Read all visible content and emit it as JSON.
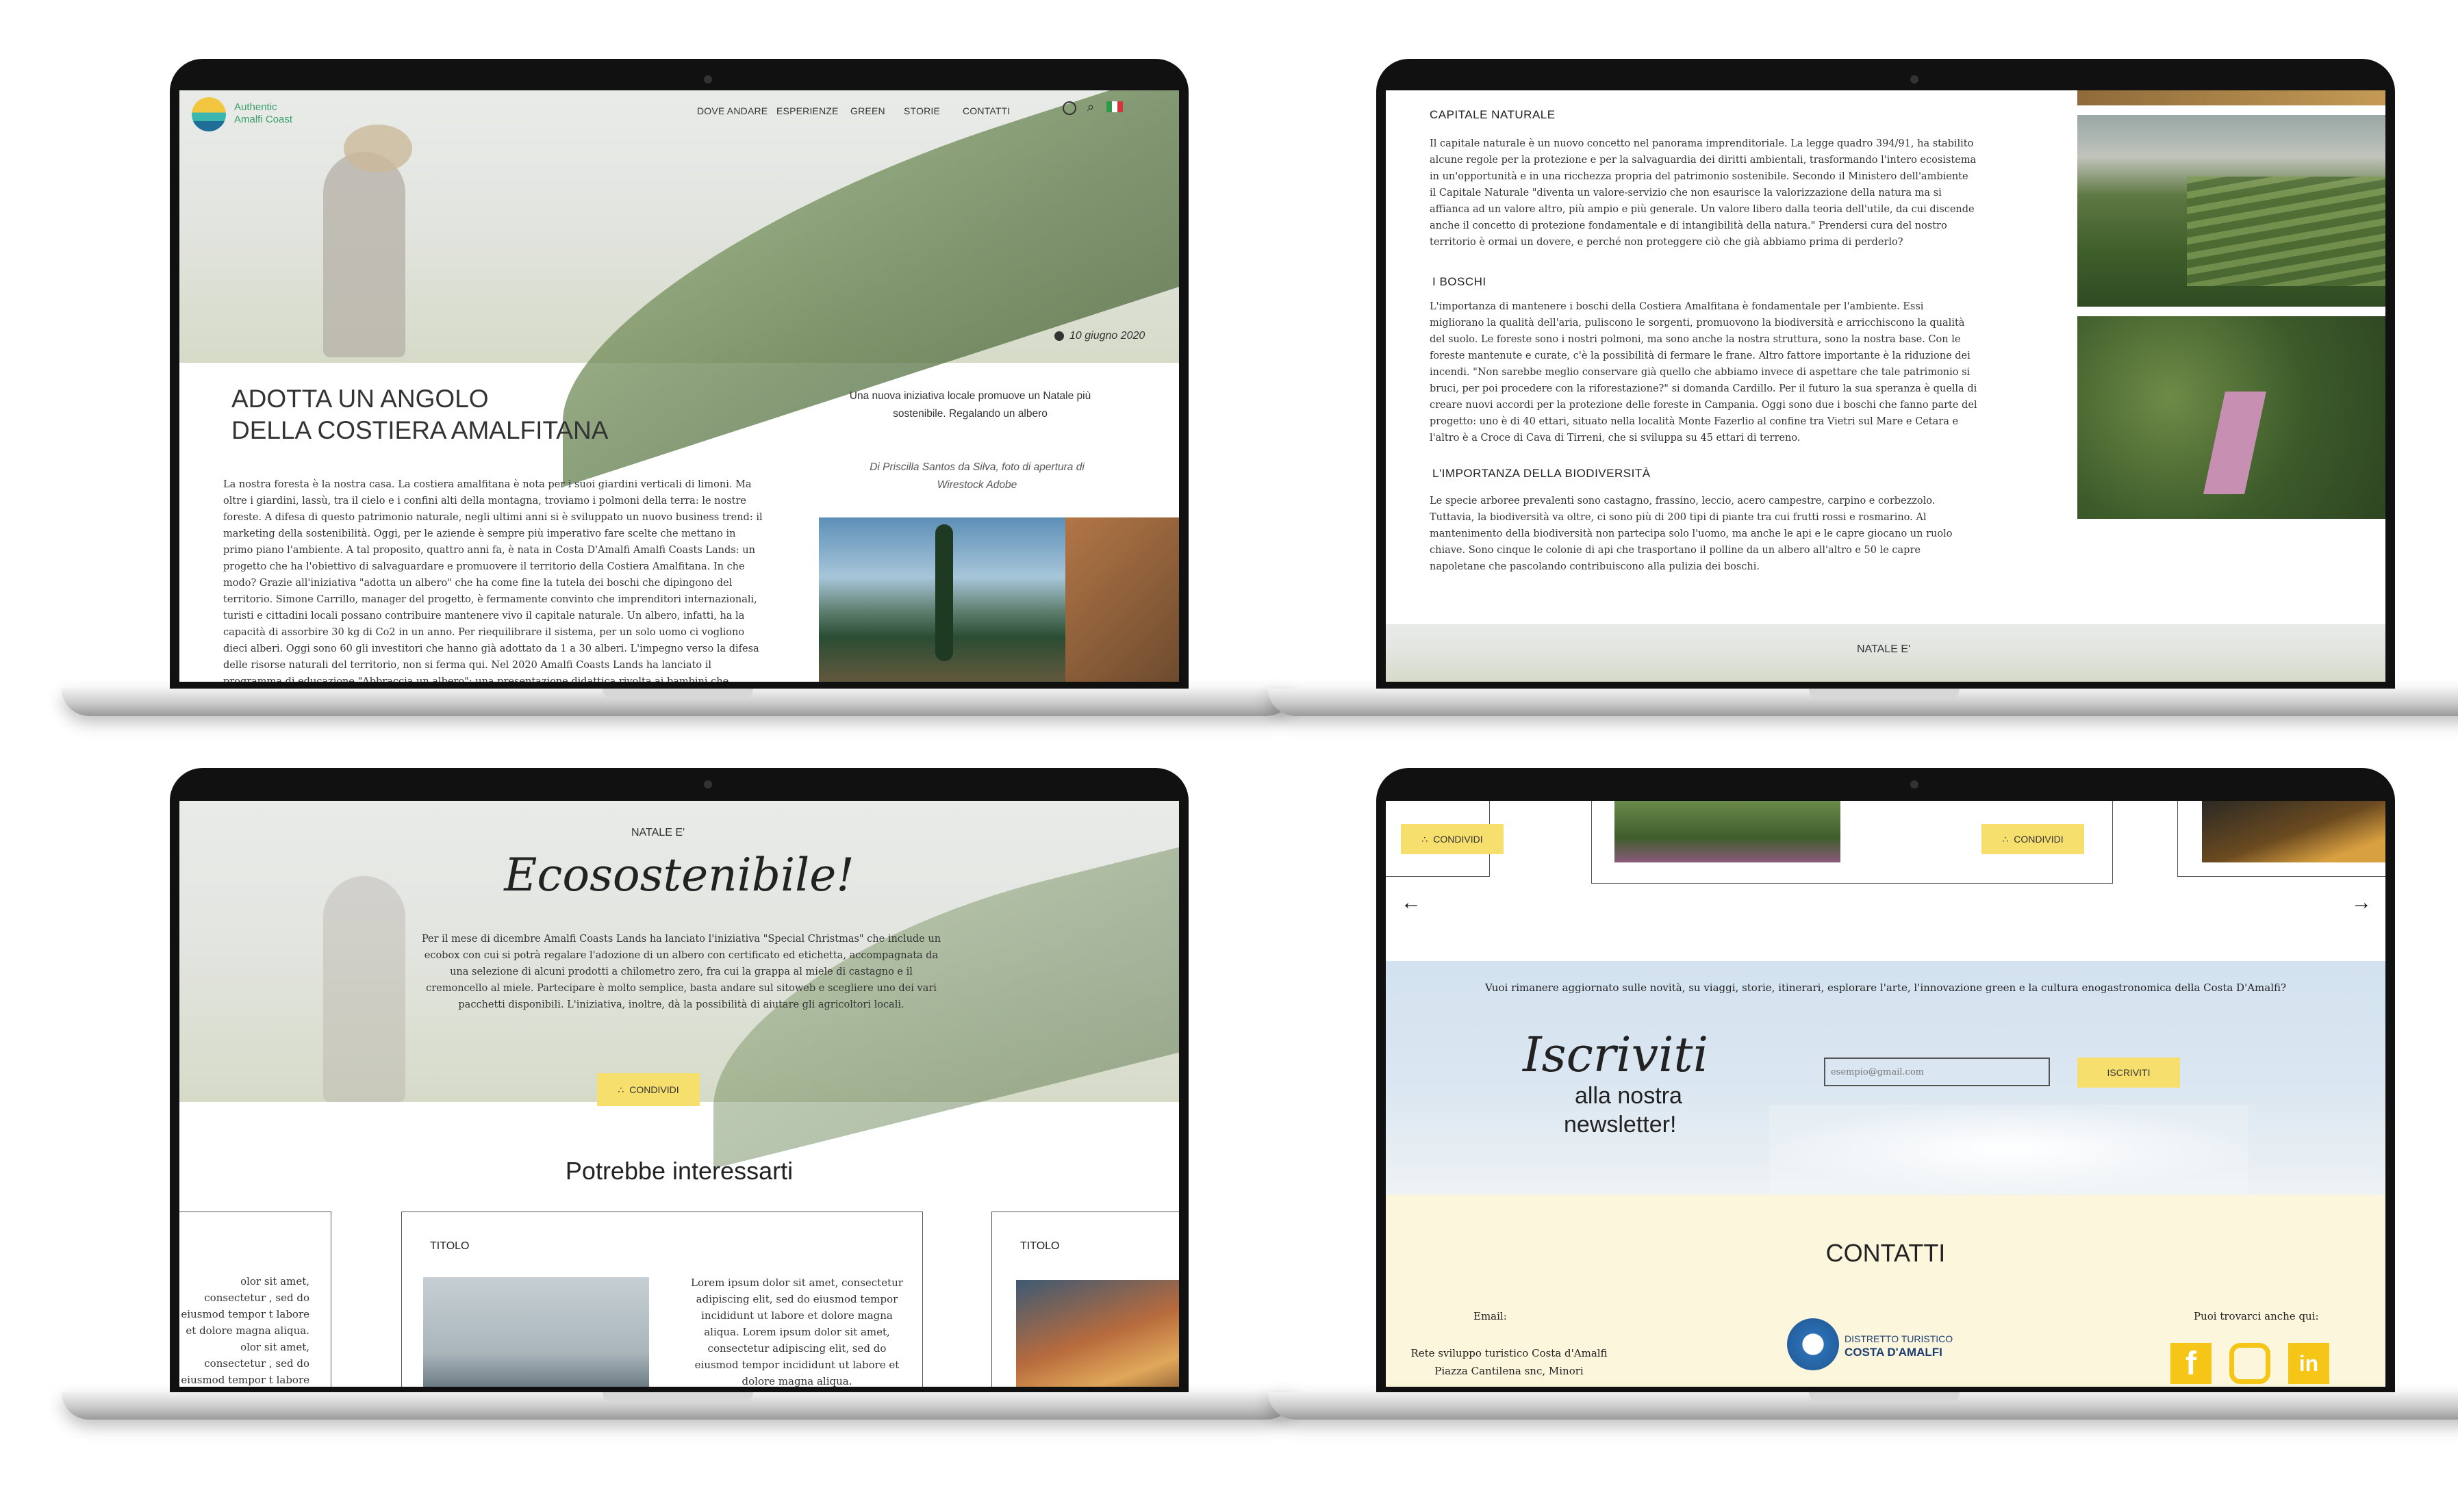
{
  "laptop1": {
    "brand_line1": "Authentic",
    "brand_line2": "Amalfi Coast",
    "nav": [
      "DOVE ANDARE",
      "ESPERIENZE",
      "GREEN",
      "STORIE",
      "CONTATTI"
    ],
    "date": "10 giugno 2020",
    "title_line1": "ADOTTA UN ANGOLO",
    "title_line2": "DELLA COSTIERA AMALFITANA",
    "subtitle": "Una nuova iniziativa locale promuove un Natale più sostenibile. Regalando un albero",
    "credit": "Di Priscilla Santos da Silva, foto di apertura di Wirestock Adobe",
    "body": "La nostra foresta è la nostra casa. La costiera amalfitana è nota per i suoi giardini verticali di limoni. Ma oltre i giardini, lassù, tra il cielo e i confini alti della montagna, troviamo i polmoni della terra: le nostre foreste. A difesa di questo patrimonio naturale, negli ultimi anni si è sviluppato un nuovo business trend: il marketing della sostenibilità. Oggi, per le aziende è sempre più imperativo fare scelte che mettano in primo piano l'ambiente. A tal proposito, quattro anni fa, è nata in Costa D'Amalfi Amalfi Coasts Lands: un progetto che ha l'obiettivo di salvaguardare e promuovere il territorio della Costiera Amalfitana. In che modo? Grazie all'iniziativa \"adotta un albero\" che ha come fine la tutela dei boschi che dipingono del territorio. Simone Carrillo, manager del progetto, è fermamente convinto che imprenditori internazionali, turisti e cittadini locali possano contribuire mantenere vivo il capitale naturale. Un albero, infatti, ha la capacità di assorbire 30 kg di Co2 in un anno. Per riequilibrare il sistema, per un solo uomo ci vogliono dieci alberi. Oggi sono 60 gli investitori che hanno già adottato da 1 a 30 alberi. L'impegno verso la difesa delle risorse naturali del territorio, non si ferma qui. Nel 2020 Amalfi Coasts Lands ha lanciato il programma di educazione \"Abbraccia un albero\": una presentazione didattica rivolta ai bambini che"
  },
  "laptop2": {
    "h1": "CAPITALE NATURALE",
    "p1": "Il capitale naturale è un nuovo concetto nel panorama imprenditoriale. La legge quadro 394/91, ha stabilito alcune regole per la protezione e per la salvaguardia dei diritti ambientali, trasformando l'intero ecosistema in un'opportunità e in una ricchezza propria del patrimonio sostenibile. Secondo il Ministero dell'ambiente il Capitale Naturale \"diventa un valore-servizio che non esaurisce la valorizzazione della natura ma si affianca ad un valore altro, più ampio e più generale. Un valore libero dalla teoria dell'utile, da cui discende anche il concetto di protezione fondamentale e di intangibilità della natura.\" Prendersi cura del nostro territorio è ormai un dovere, e perché non proteggere ciò che già abbiamo prima di perderlo?",
    "h2": "I BOSCHI",
    "p2": "L'importanza di mantenere i boschi della Costiera Amalfitana è fondamentale per l'ambiente. Essi migliorano la qualità dell'aria, puliscono le sorgenti, promuovono la biodiversità e arricchiscono la qualità del suolo. Le foreste sono i nostri polmoni, ma sono anche la nostra struttura, sono la nostra base. Con le foreste mantenute e curate, c'è la possibilità di fermare le frane. Altro fattore importante è la riduzione dei incendi. \"Non sarebbe meglio conservare già quello che abbiamo invece di aspettare che tale patrimonio si bruci, per poi procedere con la riforestazione?\" si domanda Cardillo. Per il futuro la sua speranza è quella di creare nuovi accordi per la protezione delle foreste in Campania. Oggi sono due i boschi che fanno parte del progetto: uno è di 40 ettari, situato nella località Monte Fazerlio al confine tra Vietri sul Mare e Cetara e l'altro è a Croce di Cava di Tirreni, che si sviluppa su 45 ettari di terreno.",
    "h3": "L'IMPORTANZA DELLA BIODIVERSITÀ",
    "p3": "Le specie arboree prevalenti sono castagno, frassino, leccio, acero campestre, carpino e corbezzolo. Tuttavia, la biodiversità va oltre, ci sono più di 200 tipi di piante tra cui frutti rossi e rosmarino. Al mantenimento della biodiversità non partecipa solo l'uomo, ma anche le api e le capre giocano un ruolo chiave. Sono cinque le colonie di api che trasportano il polline da un albero all'altro e 50 le capre napoletane che pascolando contribuiscono alla pulizia dei boschi.",
    "footer_label": "NATALE E'"
  },
  "laptop3": {
    "kicker": "NATALE E'",
    "script_title": "Ecosostenibile!",
    "body": "Per il mese di dicembre Amalfi Coasts Lands ha lanciato l'iniziativa \"Special Christmas\" che include un ecobox con cui si potrà regalare l'adozione di un albero con certificato ed etichetta, accompagnata da una selezione di alcuni prodotti a chilometro zero, fra cui la grappa al miele di castagno e il cremoncello al miele. Partecipare è molto semplice, basta andare sul sitoweb e scegliere uno dei vari pacchetti disponibili. L'iniziativa, inoltre, dà la possibilità di aiutare gli agricoltori locali.",
    "share_label": "CONDIVIDI",
    "related_title": "Potrebbe interessarti",
    "card_title": "TITOLO",
    "card_text": "Lorem ipsum dolor sit amet, consectetur adipiscing elit, sed do eiusmod tempor incididunt ut labore et dolore magna aliqua. Lorem ipsum dolor sit amet, consectetur adipiscing elit, sed do eiusmod tempor incididunt ut labore et dolore magna aliqua.",
    "left_card_text": "olor sit amet, consectetur , sed do eiusmod tempor t labore et dolore magna aliqua. olor sit amet, consectetur , sed do eiusmod tempor t labore et dolore magna aliqua."
  },
  "laptop4": {
    "share_label": "CONDIVIDI",
    "newsletter_text": "Vuoi rimanere aggiornato sulle novità, su viaggi, storie, itinerari, esplorare l'arte, l'innovazione green e la cultura enogastronomica della Costa D'Amalfi?",
    "script_title": "Iscriviti",
    "sub1": "alla nostra",
    "sub2": "newsletter!",
    "email_placeholder": "esempio@gmail.com",
    "subscribe_label": "ISCRIVITI",
    "contacts_title": "CONTATTI",
    "email_label": "Email:",
    "address1": "Rete sviluppo turistico Costa d'Amalfi",
    "address2": "Piazza Cantilena snc, Minori",
    "district1": "DISTRETTO TURISTICO",
    "district2": "COSTA D'AMALFI",
    "social_label": "Puoi trovarci anche qui:",
    "social": [
      "facebook-icon",
      "instagram-icon",
      "linkedin-icon"
    ]
  },
  "colors": {
    "accent_yellow": "#f7df6e",
    "footer_cream": "#fbf6dc",
    "newsletter_sky": "#d9e6f2"
  }
}
